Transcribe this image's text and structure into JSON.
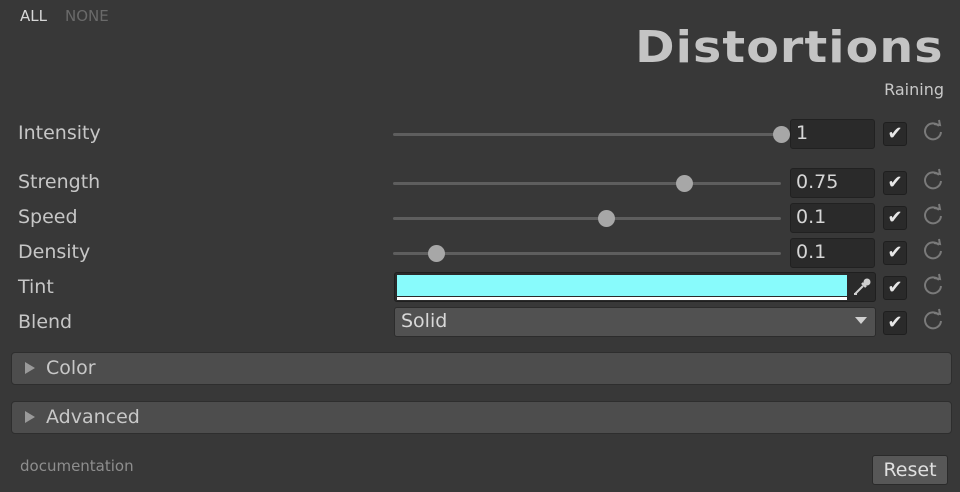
{
  "toggles": {
    "all_label": "ALL",
    "none_label": "NONE"
  },
  "header": {
    "title": "Distortions",
    "subtitle": "Raining"
  },
  "params": {
    "intensity": {
      "label": "Intensity",
      "value": "1",
      "slider_fraction": 1.0,
      "enabled": true
    },
    "strength": {
      "label": "Strength",
      "value": "0.75",
      "slider_fraction": 0.75,
      "enabled": true
    },
    "speed": {
      "label": "Speed",
      "value": "0.1",
      "slider_fraction": 0.55,
      "enabled": true
    },
    "density": {
      "label": "Density",
      "value": "0.1",
      "slider_fraction": 0.11,
      "enabled": true
    },
    "tint": {
      "label": "Tint",
      "color": "#88fbfc",
      "enabled": true
    },
    "blend": {
      "label": "Blend",
      "value": "Solid",
      "enabled": true
    }
  },
  "sections": {
    "color": "Color",
    "advanced": "Advanced"
  },
  "footer": {
    "documentation": "documentation",
    "reset": "Reset"
  },
  "icons": {
    "check": "✔",
    "reset": "refresh-icon",
    "picker": "eyedropper-icon",
    "foldout": "triangle-right-icon"
  }
}
